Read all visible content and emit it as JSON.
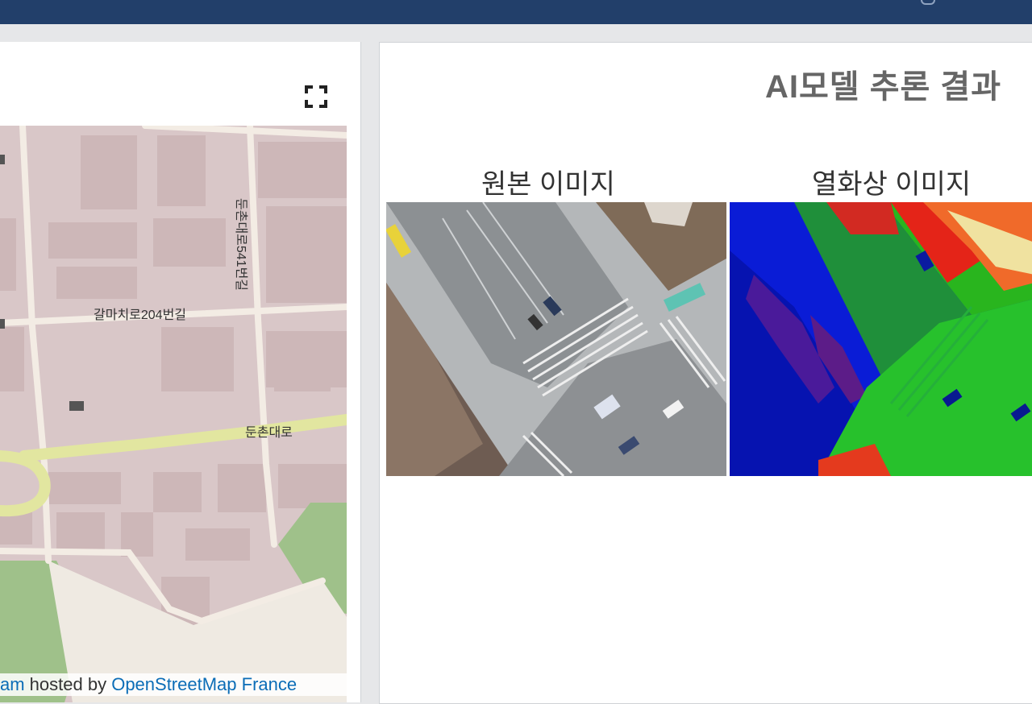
{
  "map": {
    "road_labels": {
      "road_a": "갈마치로204번길",
      "road_b": "둔촌대로541번길",
      "road_c": "둔촌대로"
    },
    "attribution": {
      "prefix": "am",
      "middle": " hosted by ",
      "link": "OpenStreetMap France"
    }
  },
  "result": {
    "title": "AI모델 추론 결과",
    "original_label": "원본 이미지",
    "thermal_label": "열화상 이미지"
  },
  "colors": {
    "topbar": "#223f6a",
    "map_bg": "#d9c7c8",
    "map_road": "#f3ece4",
    "map_major_road": "#e2e6a0",
    "map_park": "#9fc18a",
    "link": "#0b6db7"
  },
  "icons": [
    "fullscreen-icon"
  ]
}
